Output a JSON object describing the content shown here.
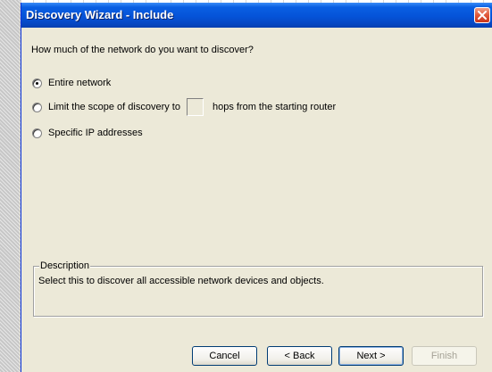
{
  "window": {
    "title": "Discovery Wizard - Include",
    "close_icon": "close-icon"
  },
  "question": "How much of the network do you want to discover?",
  "options": [
    {
      "label": "Entire network",
      "checked": true
    },
    {
      "label": "Limit the scope of discovery to",
      "suffix": "hops from the starting router",
      "hops_value": "",
      "checked": false
    },
    {
      "label": "Specific IP addresses",
      "checked": false
    }
  ],
  "description": {
    "legend": "Description",
    "text": "Select this to discover all accessible network devices and objects."
  },
  "buttons": {
    "cancel": "Cancel",
    "back": "< Back",
    "next": "Next >",
    "finish": "Finish"
  }
}
